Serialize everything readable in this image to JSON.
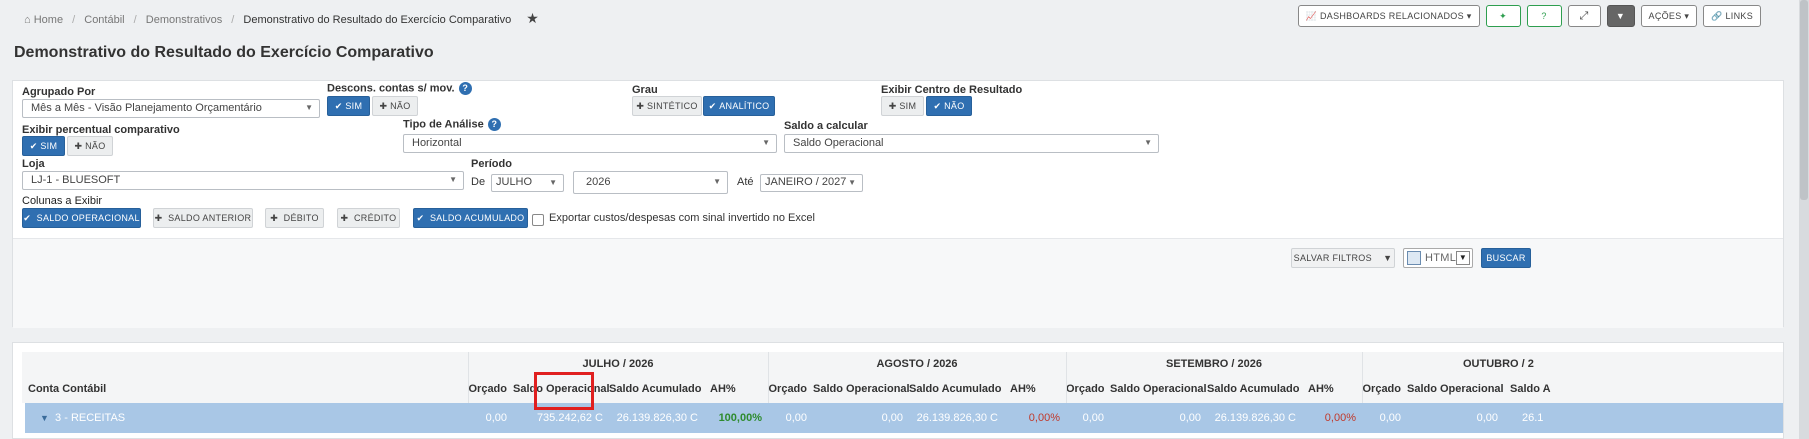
{
  "breadcrumb": {
    "home": "Home",
    "items": [
      "Contábil",
      "Demonstrativos"
    ],
    "current": "Demonstrativo do Resultado do Exercício Comparativo",
    "star_icon": "star-icon"
  },
  "toolbar": {
    "dashboards": "DASHBOARDS RELACIONADOS",
    "acoes": "AÇÕES",
    "links": "LINKS"
  },
  "page": {
    "title": "Demonstrativo do Resultado do Exercício Comparativo"
  },
  "filters": {
    "agrupado_por": {
      "label": "Agrupado Por",
      "value": "Mês a Mês - Visão Planejamento Orçamentário"
    },
    "descons": {
      "label": "Descons. contas s/ mov.",
      "sim": "SIM",
      "nao": "NÃO"
    },
    "grau": {
      "label": "Grau",
      "sintetico": "SINTÉTICO",
      "analitico": "ANALÍTICO"
    },
    "centro": {
      "label": "Exibir Centro de Resultado",
      "sim": "SIM",
      "nao": "NÃO"
    },
    "percentual": {
      "label": "Exibir percentual comparativo",
      "sim": "SIM",
      "nao": "NÃO"
    },
    "tipo_analise": {
      "label": "Tipo de Análise",
      "value": "Horizontal"
    },
    "saldo_calcular": {
      "label": "Saldo a calcular",
      "value": "Saldo Operacional"
    },
    "loja": {
      "label": "Loja",
      "value": "LJ-1 - BLUESOFT"
    },
    "periodo": {
      "label": "Período",
      "de": "De",
      "mes": "JULHO",
      "ano": "2026",
      "ate": "Até",
      "ate_value": "JANEIRO / 2027"
    },
    "colunas": {
      "label": "Colunas a Exibir",
      "saldo_operacional": "SALDO OPERACIONAL",
      "saldo_anterior": "SALDO ANTERIOR",
      "debito": "DÉBITO",
      "credito": "CRÉDITO",
      "saldo_acumulado": "SALDO ACUMULADO"
    },
    "exportar": "Exportar custos/despesas com sinal invertido no Excel",
    "salvar": "SALVAR FILTROS",
    "formato": "HTML",
    "buscar": "BUSCAR"
  },
  "table": {
    "conta_header": "Conta Contábil",
    "months": [
      "JULHO / 2026",
      "AGOSTO / 2026",
      "SETEMBRO / 2026",
      "OUTUBRO / 2"
    ],
    "columns": [
      "Orçado",
      "Saldo Operacional",
      "Saldo Acumulado",
      "AH%"
    ],
    "row": {
      "label": "3 - RECEITAS",
      "jul": [
        "0,00",
        "735.242,62 C",
        "26.139.826,30 C",
        "100,00%"
      ],
      "ago": [
        "0,00",
        "0,00",
        "26.139.826,30 C",
        "0,00%"
      ],
      "set": [
        "0,00",
        "0,00",
        "26.139.826,30 C",
        "0,00%"
      ],
      "out": [
        "0,00",
        "0,00",
        "26.1"
      ]
    },
    "partial_col": "Saldo A"
  },
  "colors": {
    "primary": "#2f6fb1",
    "row_highlight": "#a9c7e6",
    "positive": "#2e8b2e",
    "negative": "#c0392b",
    "annotation": "#e02020"
  }
}
